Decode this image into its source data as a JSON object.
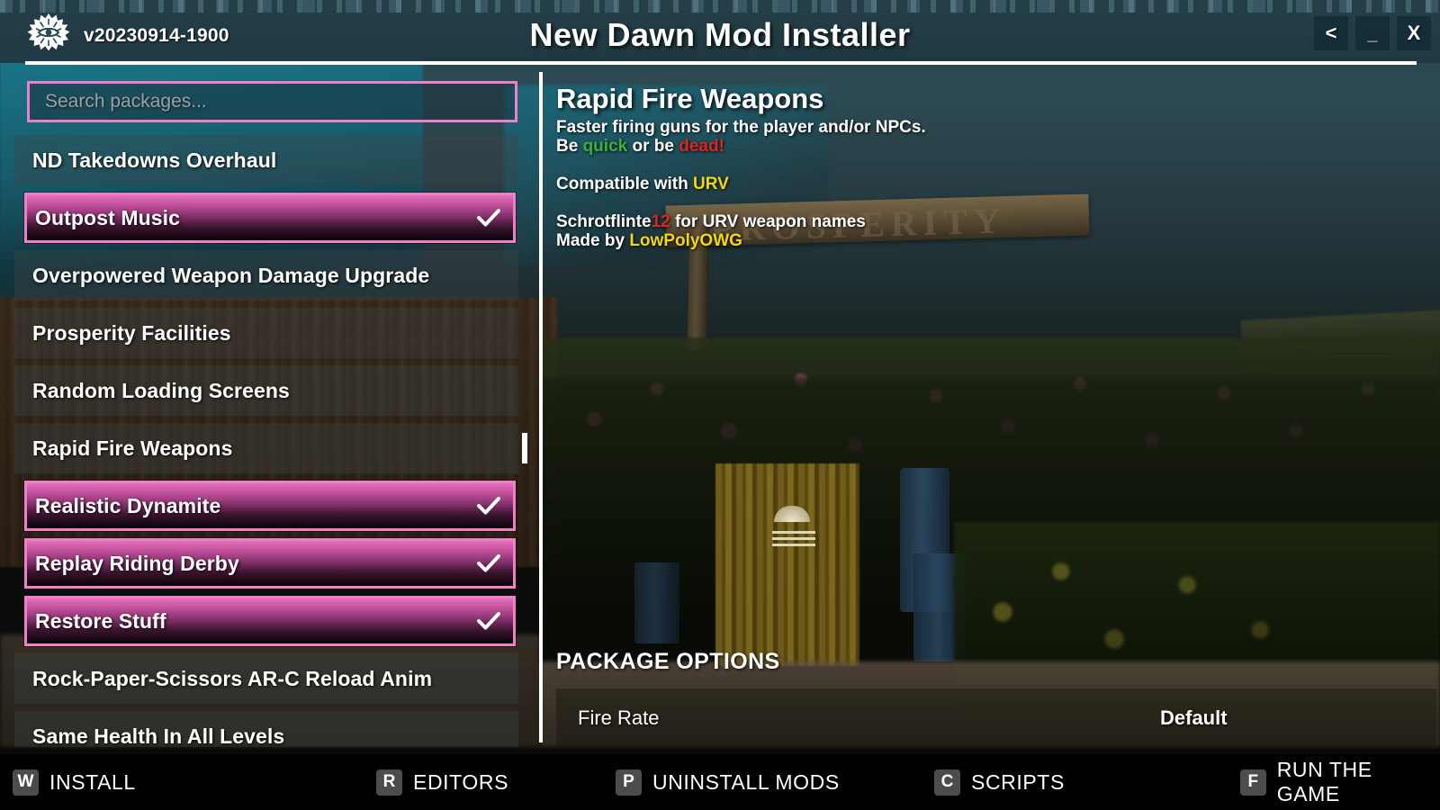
{
  "window": {
    "version": "v20230914-1900",
    "title": "New Dawn Mod Installer",
    "logo_icon": "eye-sunburst-icon",
    "controls": {
      "back": "<",
      "minimize": "_",
      "close": "X"
    }
  },
  "search": {
    "placeholder": "Search packages..."
  },
  "packages": [
    {
      "name": "ND Takedowns Overhaul",
      "selected": false
    },
    {
      "name": "Outpost Music",
      "selected": true
    },
    {
      "name": "Overpowered Weapon Damage Upgrade",
      "selected": false
    },
    {
      "name": "Prosperity Facilities",
      "selected": false
    },
    {
      "name": "Random Loading Screens",
      "selected": false
    },
    {
      "name": "Rapid Fire Weapons",
      "selected": false
    },
    {
      "name": "Realistic Dynamite",
      "selected": true
    },
    {
      "name": "Replay Riding Derby",
      "selected": true
    },
    {
      "name": "Restore Stuff",
      "selected": true
    },
    {
      "name": "Rock-Paper-Scissors AR-C Reload Anim",
      "selected": false
    },
    {
      "name": "Same Health In All Levels",
      "selected": false
    }
  ],
  "detail": {
    "title": "Rapid Fire Weapons",
    "line1": "Faster firing guns for the player and/or NPCs.",
    "line2_pre": "Be ",
    "line2_green": "quick",
    "line2_mid": " or be ",
    "line2_red": "dead!",
    "line3_pre": "Compatible with ",
    "line3_yellow": "URV",
    "line4_pre": "Schrotflinte",
    "line4_red": "12",
    "line4_post": " for URV weapon names",
    "line5_pre": "Made by ",
    "line5_yellow": "LowPolyOWG"
  },
  "options": {
    "heading": "PACKAGE OPTIONS",
    "rows": [
      {
        "name": "Fire Rate",
        "value": "Default"
      }
    ]
  },
  "bottom_bar": [
    {
      "key": "W",
      "action": "INSTALL"
    },
    {
      "key": "R",
      "action": "EDITORS"
    },
    {
      "key": "P",
      "action": "UNINSTALL MODS"
    },
    {
      "key": "C",
      "action": "SCRIPTS"
    },
    {
      "key": "F",
      "action": "RUN THE GAME"
    }
  ],
  "colors": {
    "accent_pink": "#ef7fc6",
    "selected_gradient_top": "#e370ba",
    "header_teal": "#243e48",
    "green": "#3fae3f",
    "red": "#d62727",
    "yellow": "#f2d712",
    "bottom_bar_bg": "#000000",
    "key_badge_bg": "#4c4c4c"
  }
}
